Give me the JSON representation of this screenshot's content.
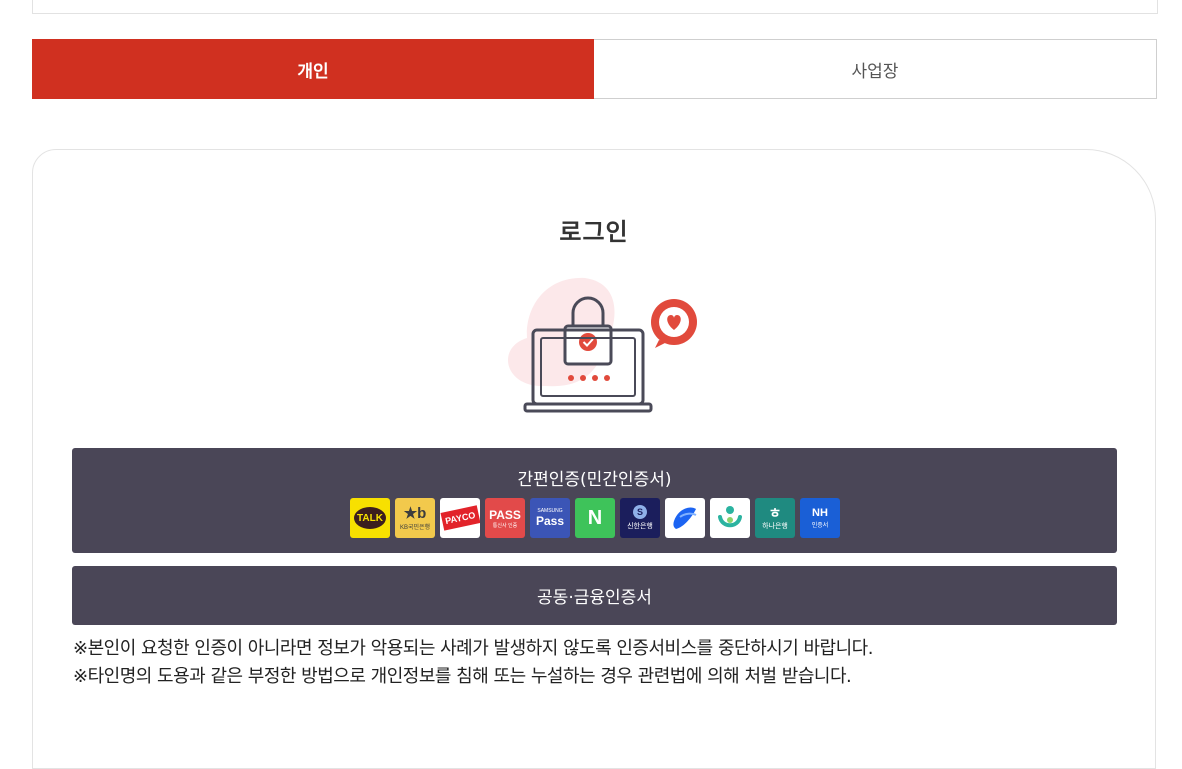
{
  "tabs": [
    {
      "label": "개인",
      "active": true
    },
    {
      "label": "사업장",
      "active": false
    }
  ],
  "login": {
    "title": "로그인",
    "simple_auth_label": "간편인증(민간인증서)",
    "joint_cert_label": "공동·금융인증서"
  },
  "providers": [
    {
      "name": "kakao-talk",
      "text": "TALK",
      "bg": "#f7e000",
      "fg": "#3c1e1e"
    },
    {
      "name": "kb",
      "text": "★b",
      "sub": "KB국민은행",
      "bg": "#f2c94c",
      "fg": "#3d3d3d"
    },
    {
      "name": "payco",
      "text": "PAYCO",
      "bg": "#ffffff",
      "fg": "#e2232a"
    },
    {
      "name": "pass",
      "text": "PASS",
      "sub": "통신사 인증",
      "bg": "#e24a4a",
      "fg": "#ffffff"
    },
    {
      "name": "samsung-pass",
      "text": "Pass",
      "sub": "SAMSUNG",
      "bg": "#3b55b6",
      "fg": "#ffffff"
    },
    {
      "name": "naver",
      "text": "N",
      "bg": "#3ec35a",
      "fg": "#ffffff"
    },
    {
      "name": "shinhan",
      "text": "S",
      "sub": "신한은행",
      "bg": "#1b1e5c",
      "fg": "#ffffff"
    },
    {
      "name": "toss",
      "text": "",
      "bg": "#ffffff",
      "fg": "#1c64f2"
    },
    {
      "name": "health",
      "text": "",
      "bg": "#ffffff",
      "fg": "#2bb3a0"
    },
    {
      "name": "hana",
      "text": "ㅎ",
      "sub": "하나은행",
      "bg": "#1f8a80",
      "fg": "#ffffff"
    },
    {
      "name": "nh",
      "text": "NH",
      "sub": "인증서",
      "bg": "#1a5fd6",
      "fg": "#ffffff"
    }
  ],
  "notices": [
    "※본인이 요청한 인증이 아니라면 정보가 악용되는 사례가 발생하지 않도록 인증서비스를 중단하시기 바랍니다.",
    "※타인명의 도용과 같은 부정한 방법으로 개인정보를 침해 또는 누설하는 경우 관련법에 의해 처벌 받습니다."
  ],
  "colors": {
    "accent": "#d03020",
    "button_dark": "#4a4657"
  }
}
